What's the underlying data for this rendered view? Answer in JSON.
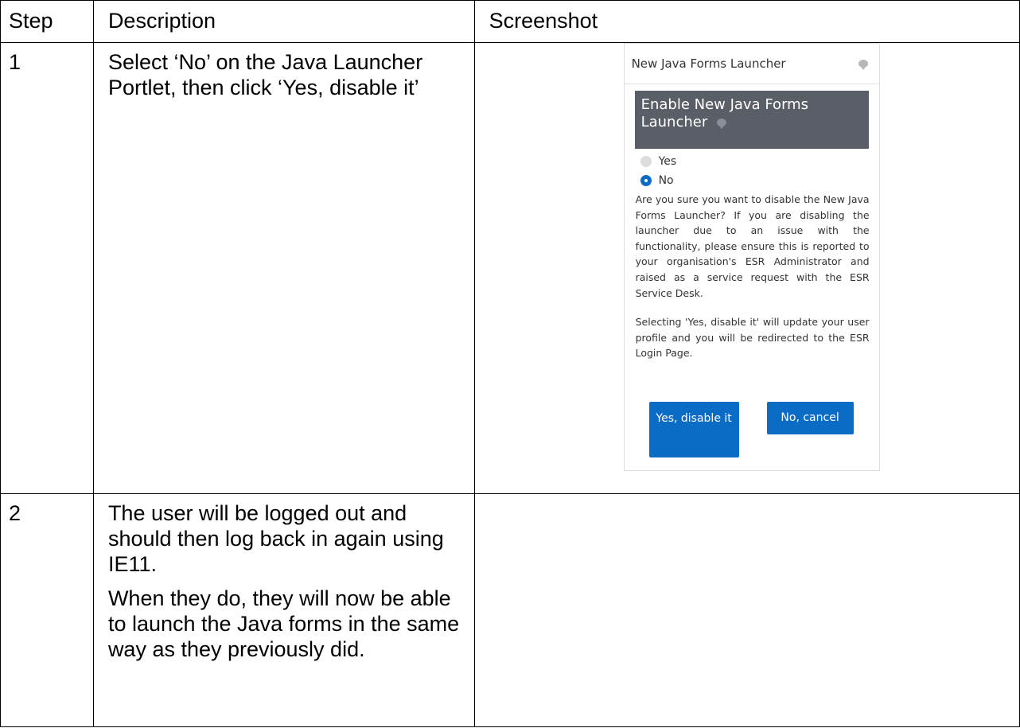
{
  "table": {
    "headers": {
      "step": "Step",
      "description": "Description",
      "screenshot": "Screenshot"
    },
    "rows": [
      {
        "step": "1",
        "description": [
          "Select ‘No’ on the Java Launcher Portlet, then click ‘Yes, disable it’"
        ]
      },
      {
        "step": "2",
        "description": [
          "The user will be logged out and should then log back in again using IE11.",
          "When they do, they will now be able to launch the Java forms in the same way as they previously did."
        ]
      }
    ]
  },
  "portlet": {
    "title": "New Java Forms Launcher",
    "section_heading": "Enable New Java Forms Launcher",
    "radio_options": [
      "Yes",
      "No"
    ],
    "selected_option": "No",
    "paragraphs": [
      "Are you sure you want to disable the New Java Forms Launcher? If you are disabling the launcher due to an issue with the functionality, please ensure this is reported to your organisation's ESR Administrator and raised as a service request with the ESR Service Desk.",
      "Selecting 'Yes, disable it' will update your user profile and you will be redirected to the ESR Login Page."
    ],
    "buttons": {
      "confirm": "Yes, disable it",
      "cancel": "No, cancel"
    },
    "icons": {
      "help": "help-icon"
    },
    "colors": {
      "heading_bg": "#5a5e66",
      "button_bg": "#0b6cc6",
      "radio_selected": "#0b6cc6"
    }
  }
}
